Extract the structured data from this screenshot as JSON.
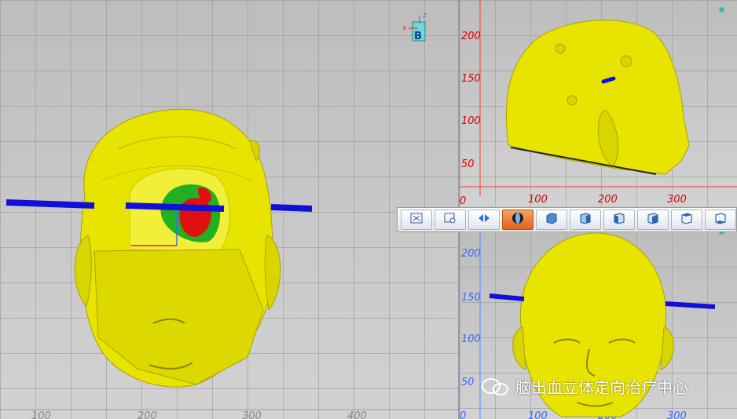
{
  "main_view": {
    "x_ticks": [
      "100",
      "200",
      "300",
      "400"
    ],
    "orientation_cube": {
      "letter": "B",
      "axis_x": "x",
      "axis_z": "z"
    }
  },
  "right_top_view": {
    "y_ticks": [
      "200",
      "150",
      "100",
      "50",
      "0"
    ],
    "x_ticks": [
      "100",
      "200",
      "300"
    ],
    "corner_marker": "R"
  },
  "right_bottom_view": {
    "y_ticks": [
      "200",
      "150",
      "100",
      "50",
      "0"
    ],
    "x_ticks": [
      "100",
      "200",
      "300"
    ],
    "corner_marker": "A"
  },
  "toolbar": {
    "buttons": [
      {
        "name": "fit-view-button",
        "icon": "fit-screen-icon"
      },
      {
        "name": "zoom-window-button",
        "icon": "zoom-window-icon"
      },
      {
        "name": "rotate-view-button",
        "icon": "rotate-icon"
      },
      {
        "name": "shaded-view-button",
        "icon": "shaded-sphere-icon",
        "active": true
      },
      {
        "name": "view-front-button",
        "icon": "cube-front-icon"
      },
      {
        "name": "view-back-button",
        "icon": "cube-back-icon"
      },
      {
        "name": "view-left-button",
        "icon": "cube-left-icon"
      },
      {
        "name": "view-right-button",
        "icon": "cube-right-icon"
      },
      {
        "name": "view-top-button",
        "icon": "cube-top-icon"
      },
      {
        "name": "view-bottom-button",
        "icon": "cube-bottom-icon"
      }
    ]
  },
  "watermark": {
    "text": "脑出血立体定向治疗中心"
  },
  "colors": {
    "skull": "#e8e400",
    "skull_dark": "#b8b400",
    "hematoma_red": "#e01010",
    "hematoma_green": "#22b022",
    "trajectory_blue": "#1010d8",
    "axis_red": "#ff1a1a",
    "axis_blue": "#3a6cff"
  }
}
